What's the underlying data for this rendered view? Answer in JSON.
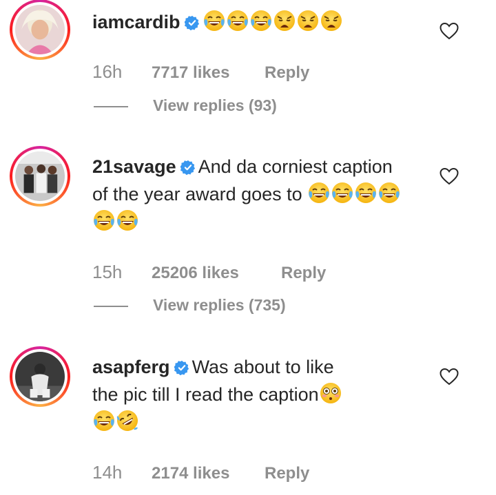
{
  "comments": [
    {
      "username": "iamcardib",
      "text": "",
      "emojis": [
        "joy",
        "joy",
        "joy",
        "weary",
        "weary",
        "weary"
      ],
      "time": "16h",
      "likes": "7717 likes",
      "reply": "Reply",
      "view_replies": "View replies (93)"
    },
    {
      "username": "21savage",
      "text": "And da corniest caption of the year award goes to",
      "emojis": [
        "joy",
        "joy",
        "joy",
        "joy",
        "joy",
        "joy"
      ],
      "time": "15h",
      "likes": "25206 likes",
      "reply": "Reply",
      "view_replies": "View replies (735)"
    },
    {
      "username": "asapferg",
      "text_line1": "Was about to like",
      "text_line2": "the pic till I read the caption",
      "emojis": [
        "flushed",
        "joy",
        "rofl"
      ],
      "time": "14h",
      "likes": "2174 likes",
      "reply": "Reply"
    }
  ],
  "colors": {
    "text": "#262626",
    "secondary": "#8e8e8e",
    "verified": "#3897f0"
  },
  "icons": {
    "verified": "verified-badge-icon",
    "like": "heart-outline-icon"
  }
}
